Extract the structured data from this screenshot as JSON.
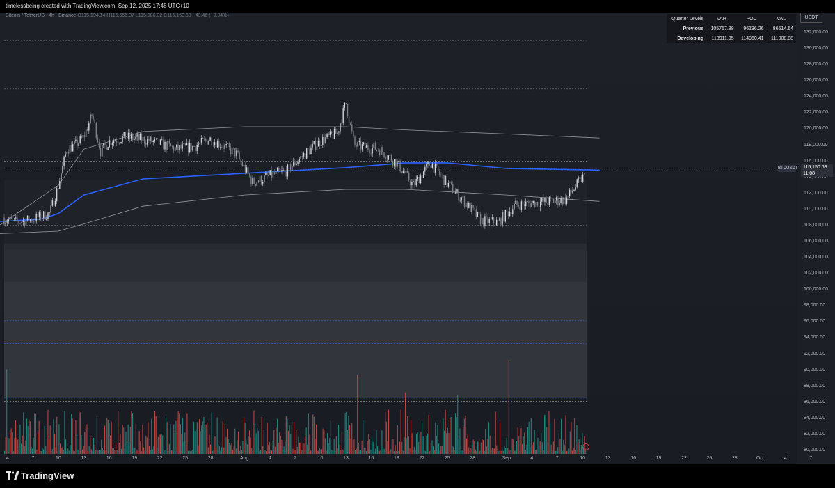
{
  "header": {
    "attribution": "timelessbeing created with TradingView.com, Sep 12, 2025 17:48 UTC+10"
  },
  "legend": {
    "symbol": "Bitcoin / TetherUS · 4h · Binance",
    "ohlc": "O115,194.14  H115,656.87  L115,086.32  C115,150.68  −43.46 (−0.04%)"
  },
  "levels_table": {
    "headers": [
      "Quarter Levels",
      "VAH",
      "POC",
      "VAL"
    ],
    "rows": [
      [
        "Previous",
        "105757.88",
        "96136.26",
        "86514.64"
      ],
      [
        "Developing",
        "118911.95",
        "114960.41",
        "111008.88"
      ]
    ]
  },
  "price_axis": {
    "currency": "USDT",
    "ticks": [
      "132,000.00",
      "130,000.00",
      "128,000.00",
      "126,000.00",
      "124,000.00",
      "122,000.00",
      "120,000.00",
      "118,000.00",
      "116,000.00",
      "114,000.00",
      "112,000.00",
      "110,000.00",
      "108,000.00",
      "106,000.00",
      "104,000.00",
      "102,000.00",
      "100,000.00",
      "98,000.00",
      "96,000.00",
      "94,000.00",
      "92,000.00",
      "90,000.00",
      "88,000.00",
      "86,000.00",
      "84,000.00",
      "82,000.00",
      "80,000.00"
    ]
  },
  "symbol_tag": "BTCUSDT",
  "last_price": {
    "price": "115,150.68",
    "countdown": "11:08"
  },
  "time_axis": [
    "4",
    "7",
    "10",
    "13",
    "16",
    "19",
    "22",
    "25",
    "28",
    "Aug",
    "4",
    "7",
    "10",
    "13",
    "16",
    "19",
    "22",
    "25",
    "28",
    "Sep",
    "4",
    "7",
    "10",
    "13",
    "16",
    "19",
    "22",
    "25",
    "28",
    "Oct",
    "4",
    "7"
  ],
  "footer": {
    "brand": "TradingView"
  },
  "colors": {
    "up": "#26a69a",
    "down": "#ef5350",
    "poc_line": "#2962ff",
    "band": "#9598a1"
  },
  "chart_data": {
    "type": "candlestick",
    "symbol": "BTCUSDT",
    "interval": "4h",
    "ylim": [
      79500,
      133000
    ],
    "y_scale": "linear",
    "grid": false,
    "close_path": {
      "dates": [
        "Jul 3",
        "Jul 5",
        "Jul 7",
        "Jul 9",
        "Jul 10",
        "Jul 11",
        "Jul 12",
        "Jul 13",
        "Jul 14",
        "Jul 15",
        "Jul 16",
        "Jul 18",
        "Jul 21",
        "Jul 24",
        "Jul 26",
        "Jul 28",
        "Jul 31",
        "Aug 2",
        "Aug 4",
        "Aug 6",
        "Aug 8",
        "Aug 10",
        "Aug 12",
        "Aug 13",
        "Aug 14",
        "Aug 15",
        "Aug 17",
        "Aug 19",
        "Aug 21",
        "Aug 23",
        "Aug 25",
        "Aug 27",
        "Aug 29",
        "Aug 31",
        "Sep 2",
        "Sep 4",
        "Sep 6",
        "Sep 8",
        "Sep 10",
        "Sep 11",
        "Sep 12"
      ],
      "close": [
        109000,
        108400,
        108800,
        109500,
        113000,
        117500,
        118000,
        119000,
        121800,
        117200,
        118500,
        119000,
        118500,
        117500,
        117800,
        118800,
        117000,
        113300,
        114200,
        114800,
        116800,
        118500,
        119500,
        123300,
        118000,
        117800,
        117500,
        115800,
        113000,
        115800,
        113200,
        111000,
        108600,
        108400,
        110500,
        110800,
        111000,
        111200,
        114000,
        114800,
        115150
      ]
    },
    "volume_profile_poc_line": {
      "dates": [
        "Jul 3",
        "Jul 8",
        "Jul 10",
        "Jul 13",
        "Jul 20",
        "Aug 1",
        "Aug 13",
        "Aug 20",
        "Aug 25",
        "Sep 1",
        "Sep 12"
      ],
      "values": [
        108500,
        108800,
        109500,
        111800,
        113800,
        114500,
        115200,
        115800,
        115800,
        115100,
        114900
      ]
    },
    "upper_band": {
      "dates": [
        "Jul 3",
        "Jul 10",
        "Jul 13",
        "Jul 20",
        "Aug 1",
        "Aug 13",
        "Aug 20",
        "Sep 1",
        "Sep 12"
      ],
      "values": [
        108000,
        113000,
        117500,
        119700,
        120300,
        120300,
        119900,
        119400,
        118900
      ]
    },
    "lower_band": {
      "dates": [
        "Jul 3",
        "Jul 10",
        "Jul 13",
        "Jul 20",
        "Aug 1",
        "Aug 13",
        "Aug 20",
        "Sep 1",
        "Sep 12"
      ],
      "values": [
        107000,
        107300,
        108200,
        110400,
        111800,
        112500,
        112500,
        111800,
        111000
      ]
    },
    "quarter_levels": {
      "previous": {
        "vah": 105757.88,
        "poc": 96136.26,
        "val": 86514.64
      },
      "developing": {
        "vah": 118911.95,
        "poc": 114960.41,
        "val": 111008.88
      }
    }
  }
}
